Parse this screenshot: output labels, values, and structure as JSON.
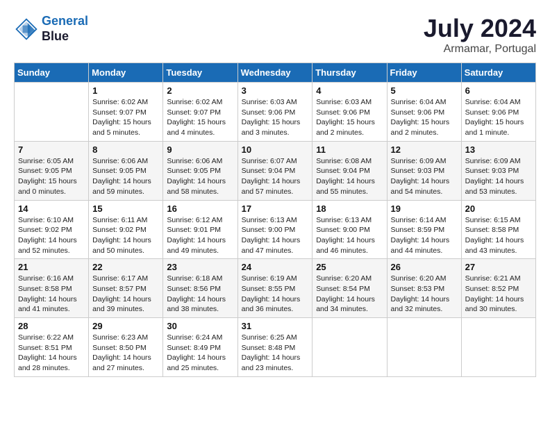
{
  "header": {
    "logo_line1": "General",
    "logo_line2": "Blue",
    "month": "July 2024",
    "location": "Armamar, Portugal"
  },
  "weekdays": [
    "Sunday",
    "Monday",
    "Tuesday",
    "Wednesday",
    "Thursday",
    "Friday",
    "Saturday"
  ],
  "weeks": [
    [
      {
        "day": "",
        "info": ""
      },
      {
        "day": "1",
        "info": "Sunrise: 6:02 AM\nSunset: 9:07 PM\nDaylight: 15 hours\nand 5 minutes."
      },
      {
        "day": "2",
        "info": "Sunrise: 6:02 AM\nSunset: 9:07 PM\nDaylight: 15 hours\nand 4 minutes."
      },
      {
        "day": "3",
        "info": "Sunrise: 6:03 AM\nSunset: 9:06 PM\nDaylight: 15 hours\nand 3 minutes."
      },
      {
        "day": "4",
        "info": "Sunrise: 6:03 AM\nSunset: 9:06 PM\nDaylight: 15 hours\nand 2 minutes."
      },
      {
        "day": "5",
        "info": "Sunrise: 6:04 AM\nSunset: 9:06 PM\nDaylight: 15 hours\nand 2 minutes."
      },
      {
        "day": "6",
        "info": "Sunrise: 6:04 AM\nSunset: 9:06 PM\nDaylight: 15 hours\nand 1 minute."
      }
    ],
    [
      {
        "day": "7",
        "info": "Sunrise: 6:05 AM\nSunset: 9:05 PM\nDaylight: 15 hours\nand 0 minutes."
      },
      {
        "day": "8",
        "info": "Sunrise: 6:06 AM\nSunset: 9:05 PM\nDaylight: 14 hours\nand 59 minutes."
      },
      {
        "day": "9",
        "info": "Sunrise: 6:06 AM\nSunset: 9:05 PM\nDaylight: 14 hours\nand 58 minutes."
      },
      {
        "day": "10",
        "info": "Sunrise: 6:07 AM\nSunset: 9:04 PM\nDaylight: 14 hours\nand 57 minutes."
      },
      {
        "day": "11",
        "info": "Sunrise: 6:08 AM\nSunset: 9:04 PM\nDaylight: 14 hours\nand 55 minutes."
      },
      {
        "day": "12",
        "info": "Sunrise: 6:09 AM\nSunset: 9:03 PM\nDaylight: 14 hours\nand 54 minutes."
      },
      {
        "day": "13",
        "info": "Sunrise: 6:09 AM\nSunset: 9:03 PM\nDaylight: 14 hours\nand 53 minutes."
      }
    ],
    [
      {
        "day": "14",
        "info": "Sunrise: 6:10 AM\nSunset: 9:02 PM\nDaylight: 14 hours\nand 52 minutes."
      },
      {
        "day": "15",
        "info": "Sunrise: 6:11 AM\nSunset: 9:02 PM\nDaylight: 14 hours\nand 50 minutes."
      },
      {
        "day": "16",
        "info": "Sunrise: 6:12 AM\nSunset: 9:01 PM\nDaylight: 14 hours\nand 49 minutes."
      },
      {
        "day": "17",
        "info": "Sunrise: 6:13 AM\nSunset: 9:00 PM\nDaylight: 14 hours\nand 47 minutes."
      },
      {
        "day": "18",
        "info": "Sunrise: 6:13 AM\nSunset: 9:00 PM\nDaylight: 14 hours\nand 46 minutes."
      },
      {
        "day": "19",
        "info": "Sunrise: 6:14 AM\nSunset: 8:59 PM\nDaylight: 14 hours\nand 44 minutes."
      },
      {
        "day": "20",
        "info": "Sunrise: 6:15 AM\nSunset: 8:58 PM\nDaylight: 14 hours\nand 43 minutes."
      }
    ],
    [
      {
        "day": "21",
        "info": "Sunrise: 6:16 AM\nSunset: 8:58 PM\nDaylight: 14 hours\nand 41 minutes."
      },
      {
        "day": "22",
        "info": "Sunrise: 6:17 AM\nSunset: 8:57 PM\nDaylight: 14 hours\nand 39 minutes."
      },
      {
        "day": "23",
        "info": "Sunrise: 6:18 AM\nSunset: 8:56 PM\nDaylight: 14 hours\nand 38 minutes."
      },
      {
        "day": "24",
        "info": "Sunrise: 6:19 AM\nSunset: 8:55 PM\nDaylight: 14 hours\nand 36 minutes."
      },
      {
        "day": "25",
        "info": "Sunrise: 6:20 AM\nSunset: 8:54 PM\nDaylight: 14 hours\nand 34 minutes."
      },
      {
        "day": "26",
        "info": "Sunrise: 6:20 AM\nSunset: 8:53 PM\nDaylight: 14 hours\nand 32 minutes."
      },
      {
        "day": "27",
        "info": "Sunrise: 6:21 AM\nSunset: 8:52 PM\nDaylight: 14 hours\nand 30 minutes."
      }
    ],
    [
      {
        "day": "28",
        "info": "Sunrise: 6:22 AM\nSunset: 8:51 PM\nDaylight: 14 hours\nand 28 minutes."
      },
      {
        "day": "29",
        "info": "Sunrise: 6:23 AM\nSunset: 8:50 PM\nDaylight: 14 hours\nand 27 minutes."
      },
      {
        "day": "30",
        "info": "Sunrise: 6:24 AM\nSunset: 8:49 PM\nDaylight: 14 hours\nand 25 minutes."
      },
      {
        "day": "31",
        "info": "Sunrise: 6:25 AM\nSunset: 8:48 PM\nDaylight: 14 hours\nand 23 minutes."
      },
      {
        "day": "",
        "info": ""
      },
      {
        "day": "",
        "info": ""
      },
      {
        "day": "",
        "info": ""
      }
    ]
  ]
}
